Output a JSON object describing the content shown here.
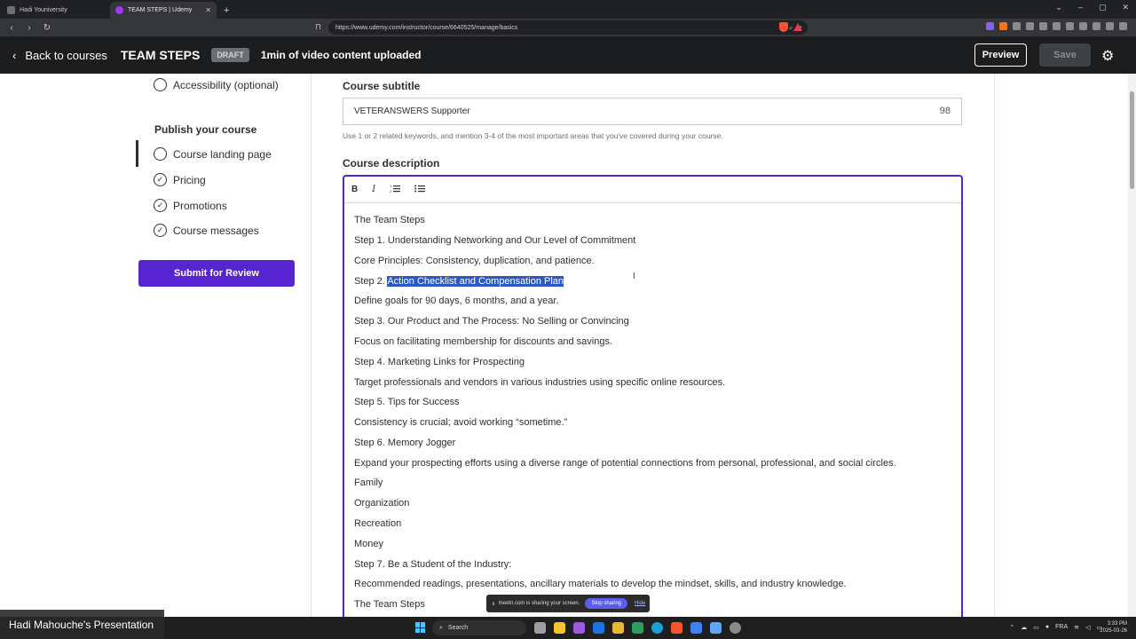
{
  "browser": {
    "tabs": [
      {
        "title": "Hadi Youniversity",
        "color": "#6a6f73"
      },
      {
        "title": "TEAM STEPS | Udemy",
        "color": "#a435f0"
      }
    ],
    "new_tab": "+",
    "url": "https://www.udemy.com/instructor/course/6640525/manage/basics"
  },
  "header": {
    "back_label": "Back to courses",
    "course_title": "TEAM STEPS",
    "status_badge": "DRAFT",
    "upload_status": "1min of video content uploaded",
    "preview_label": "Preview",
    "save_label": "Save"
  },
  "sidebar": {
    "items_top": [
      {
        "label": "Accessibility (optional)",
        "checked": false
      }
    ],
    "publish_heading": "Publish your course",
    "publish_items": [
      {
        "label": "Course landing page",
        "checked": false
      },
      {
        "label": "Pricing",
        "checked": true
      },
      {
        "label": "Promotions",
        "checked": true
      },
      {
        "label": "Course messages",
        "checked": true
      }
    ],
    "submit_label": "Submit for Review"
  },
  "main": {
    "subtitle_label": "Course subtitle",
    "subtitle_value": "VETERANSWERS Supporter",
    "subtitle_counter": "98",
    "subtitle_hint": "Use 1 or 2 related keywords, and mention 3-4 of the most important areas that you've covered during your course.",
    "description_label": "Course description",
    "toolbar": {
      "bold": "B",
      "italic": "I",
      "ordered_list": "ordered-list-icon",
      "bullet_list": "bullet-list-icon"
    },
    "description_lines": [
      "The Team Steps",
      "Step 1. Understanding Networking and Our Level of Commitment",
      "Core Principles: Consistency, duplication, and patience.",
      "Step 2. ",
      "Define goals for 90 days, 6 months, and a year.",
      "Step 3. Our Product and The Process: No Selling or Convincing",
      "Focus on facilitating membership for discounts and savings.",
      "Step 4. Marketing Links for Prospecting",
      "Target professionals and vendors in various industries using specific online resources.",
      "Step 5. Tips for Success",
      "Consistency is crucial; avoid working “sometime.”",
      "Step 6. Memory Jogger",
      "Expand your prospecting efforts using a diverse range of potential connections from personal, professional, and social circles.",
      "Family",
      "Organization",
      "Recreation",
      "Money",
      "Step 7. Be a Student of the Industry:",
      "Recommended readings, presentations, ancillary materials to develop the mindset, skills, and industry knowledge.",
      "The Team Steps"
    ],
    "selected_text": "Action Checklist and Compensation Plan"
  },
  "share_banner": {
    "message": "meetn.com is sharing your screen.",
    "stop_label": "Stop sharing",
    "hide_label": "Hide"
  },
  "taskbar": {
    "presenter": "Hadi Mahouche's Presentation",
    "search_placeholder": "Search",
    "lang": "FRA",
    "time": "3:33 PM",
    "date": "2025-03-26"
  },
  "colors": {
    "accent": "#5624d0",
    "header_bg": "#1c1d1f",
    "selection": "#2b57c7"
  }
}
